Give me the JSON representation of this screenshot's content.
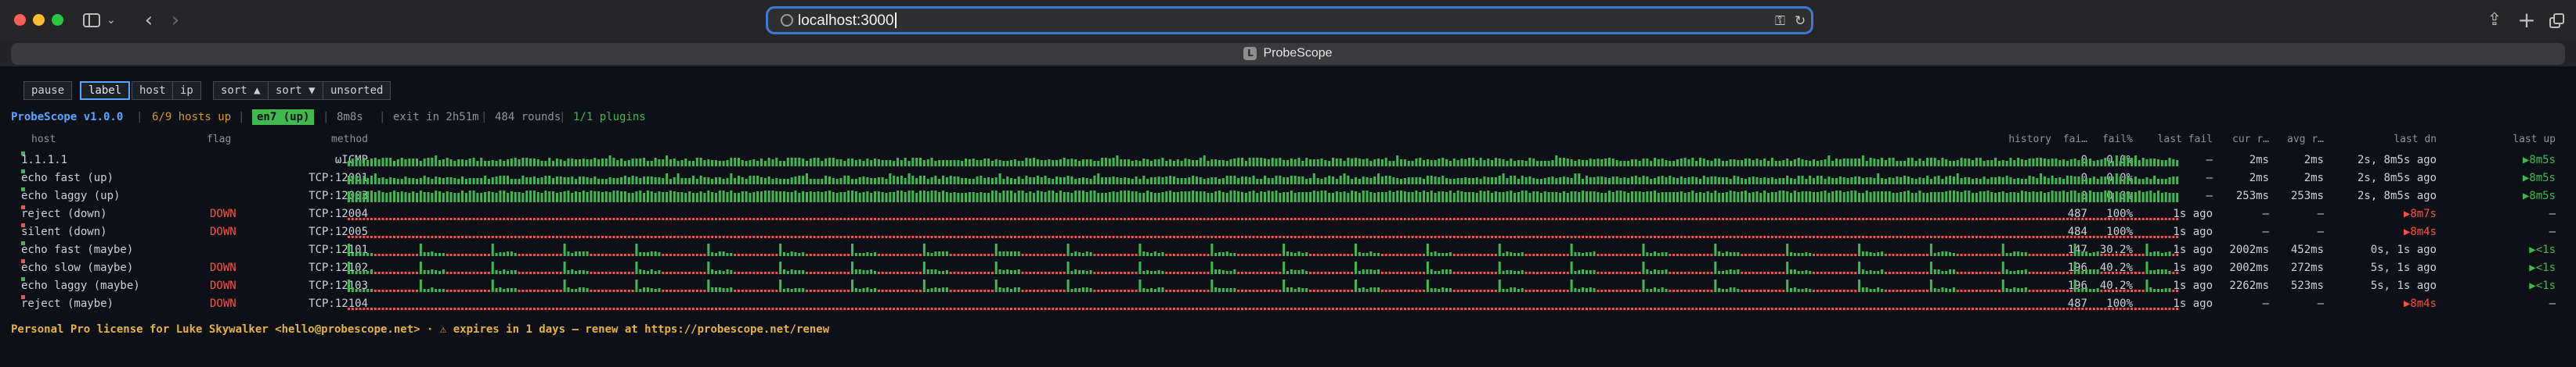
{
  "browser": {
    "url": "localhost:3000",
    "tab_title": "ProbeScope",
    "favicon_letter": "L",
    "icons": [
      "sidebar-icon",
      "chevron-down-icon",
      "back-arrow-icon",
      "forward-arrow-icon",
      "globe-icon",
      "extension-icon",
      "reload-icon",
      "share-icon",
      "new-tab-plus-icon",
      "tab-overview-icon"
    ]
  },
  "controls": {
    "pause": "pause",
    "label": "label",
    "host": "host",
    "ip": "ip",
    "sort_up": "sort ▲",
    "sort_down": "sort ▼",
    "unsorted": "unsorted"
  },
  "status": {
    "brand": "ProbeScope v1.0.0",
    "hosts_up": "6/9 hosts up",
    "sep": "|",
    "interface": "en7 (up)",
    "interval": "8m8s",
    "exit": "exit in 2h51m",
    "rounds": "484 rounds",
    "plugins": "1/1 plugins"
  },
  "columns": {
    "host": "host",
    "flag": "flag",
    "method": "method",
    "history": "history",
    "fails": "fai…",
    "fail_pct": "fail%",
    "last_fail": "last fail",
    "cur": "cur r…",
    "avg": "avg r…",
    "last_dn": "last dn",
    "last_up": "last up"
  },
  "rows": [
    {
      "host": "1.1.1.1",
      "flag": "",
      "method": "ωICMP",
      "fails": "0",
      "fail_pct": "0.0%",
      "last_fail": "—",
      "cur": "2ms",
      "avg": "2ms",
      "last_dn": "2s, 8m5s ago",
      "last_up": "▶8m5s",
      "status": "up",
      "pattern": "up"
    },
    {
      "host": "echo fast (up)",
      "flag": "",
      "method": "TCP:12001",
      "fails": "0",
      "fail_pct": "0.0%",
      "last_fail": "—",
      "cur": "2ms",
      "avg": "2ms",
      "last_dn": "2s, 8m5s ago",
      "last_up": "▶8m5s",
      "status": "up",
      "pattern": "up"
    },
    {
      "host": "echo laggy (up)",
      "flag": "",
      "method": "TCP:12003",
      "fails": "0",
      "fail_pct": "0.0%",
      "last_fail": "—",
      "cur": "253ms",
      "avg": "253ms",
      "last_dn": "2s, 8m5s ago",
      "last_up": "▶8m5s",
      "status": "up",
      "pattern": "up_tall"
    },
    {
      "host": "reject (down)",
      "flag": "DOWN",
      "method": "TCP:12004",
      "fails": "487",
      "fail_pct": "100%",
      "last_fail": "1s ago",
      "cur": "—",
      "avg": "—",
      "last_dn": "▶8m7s",
      "last_up": "—",
      "status": "down",
      "pattern": "down"
    },
    {
      "host": "silent (down)",
      "flag": "DOWN",
      "method": "TCP:12005",
      "fails": "484",
      "fail_pct": "100%",
      "last_fail": "1s ago",
      "cur": "—",
      "avg": "—",
      "last_dn": "▶8m4s",
      "last_up": "—",
      "status": "down",
      "pattern": "down"
    },
    {
      "host": "echo fast (maybe)",
      "flag": "",
      "method": "TCP:12101",
      "fails": "147",
      "fail_pct": "30.2%",
      "last_fail": "1s ago",
      "cur": "2002ms",
      "avg": "452ms",
      "last_dn": "0s, 1s ago",
      "last_up": "▶<1s",
      "status": "up",
      "pattern": "maybe"
    },
    {
      "host": "echo slow (maybe)",
      "flag": "DOWN",
      "method": "TCP:12102",
      "fails": "196",
      "fail_pct": "40.2%",
      "last_fail": "1s ago",
      "cur": "2002ms",
      "avg": "272ms",
      "last_dn": "5s, 1s ago",
      "last_up": "▶<1s",
      "status": "down",
      "pattern": "maybe"
    },
    {
      "host": "echo laggy (maybe)",
      "flag": "DOWN",
      "method": "TCP:12103",
      "fails": "196",
      "fail_pct": "40.2%",
      "last_fail": "1s ago",
      "cur": "2262ms",
      "avg": "523ms",
      "last_dn": "5s, 1s ago",
      "last_up": "▶<1s",
      "status": "up",
      "pattern": "maybe"
    },
    {
      "host": "reject (maybe)",
      "flag": "DOWN",
      "method": "TCP:12104",
      "fails": "487",
      "fail_pct": "100%",
      "last_fail": "1s ago",
      "cur": "—",
      "avg": "—",
      "last_dn": "▶8m4s",
      "last_up": "—",
      "status": "down",
      "pattern": "down"
    }
  ],
  "license": "Personal Pro license for Luke Skywalker <hello@probescope.net> · ⚠ expires in 1 days — renew at https://probescope.net/renew",
  "colors": {
    "up": "#3fb950",
    "down": "#f85149",
    "accent": "#58a6ff",
    "warn": "#e3b341",
    "hosts_up": "#d29922"
  }
}
